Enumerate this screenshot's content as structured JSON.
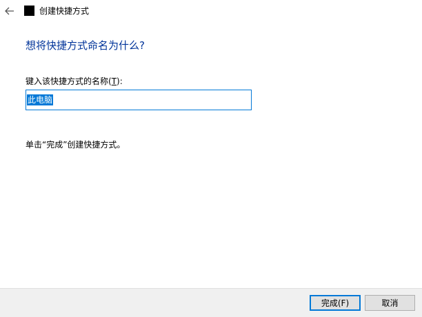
{
  "window": {
    "title": "创建快捷方式",
    "back_icon": "back-arrow-icon",
    "app_icon": "app-icon"
  },
  "main": {
    "heading": "想将快捷方式命名为什么?",
    "name_label_prefix": "键入该快捷方式的名称(",
    "name_label_key": "T",
    "name_label_suffix": "):",
    "name_value": "此电脑",
    "hint": "单击“完成”创建快捷方式。"
  },
  "footer": {
    "finish_label": "完成(F)",
    "cancel_label": "取消"
  },
  "colors": {
    "heading": "#003399",
    "accent": "#0078d7",
    "footer_bg": "#f0f0f0"
  }
}
